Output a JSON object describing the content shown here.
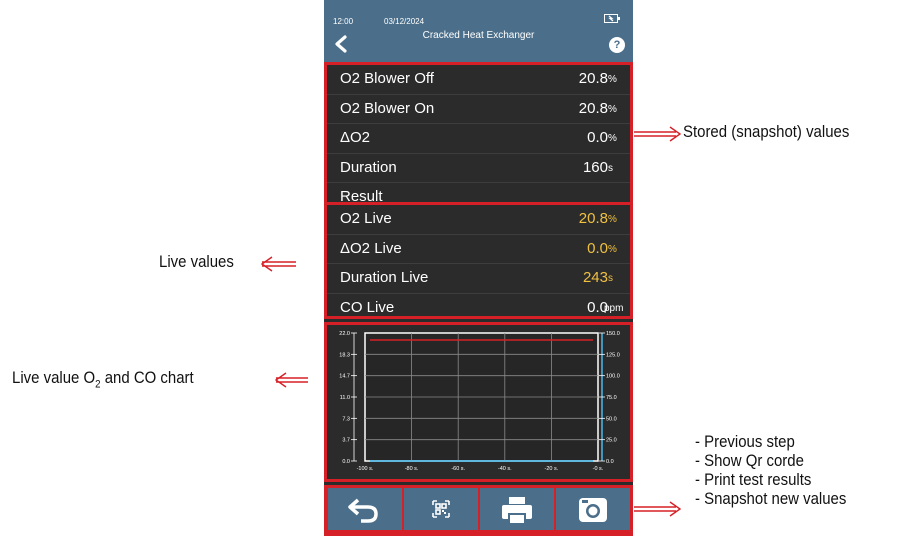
{
  "status_bar": {
    "time": "12:00",
    "date": "03/12/2024",
    "battery_icon": "battery-charging-icon"
  },
  "header": {
    "title": "Cracked Heat Exchanger",
    "back_icon": "chevron-left-icon",
    "help_label": "?"
  },
  "stored": {
    "rows": [
      {
        "label": "O2 Blower Off",
        "value": "20.8",
        "unit": "%"
      },
      {
        "label": "O2 Blower On",
        "value": "20.8",
        "unit": "%"
      },
      {
        "label": "ΔO2",
        "value": "0.0",
        "unit": "%"
      },
      {
        "label": "Duration",
        "value": "160",
        "unit": "s"
      },
      {
        "label": "Result",
        "value": "",
        "unit": ""
      }
    ]
  },
  "live": {
    "rows": [
      {
        "label": "O2 Live",
        "value": "20.8",
        "unit": "%"
      },
      {
        "label": "ΔO2 Live",
        "value": "0.0",
        "unit": "%"
      },
      {
        "label": "Duration Live",
        "value": "243",
        "unit": "s"
      },
      {
        "label": "CO Live",
        "value": "0.0",
        "unit": "ppm"
      }
    ]
  },
  "chart_data": {
    "type": "line",
    "x_ticks": [
      "-100 s.",
      "-80 s.",
      "-60 s.",
      "-40 s.",
      "-20 s.",
      "-0 s."
    ],
    "y_left_ticks": [
      "22.0",
      "18.3",
      "14.7",
      "11.0",
      "7.3",
      "3.7",
      "0.0"
    ],
    "y_right_ticks": [
      "150.0",
      "125.0",
      "100.0",
      "75.0",
      "50.0",
      "25.0",
      "0.0"
    ],
    "y_left_lim": [
      0,
      22
    ],
    "y_right_lim": [
      0,
      150
    ],
    "grid": true,
    "series": [
      {
        "axis": "left",
        "color": "#d62027",
        "x": [
          -100,
          -80,
          -60,
          -40,
          -20,
          0
        ],
        "y": [
          20.8,
          20.8,
          20.8,
          20.8,
          20.8,
          20.8
        ]
      },
      {
        "axis": "right",
        "color": "#4fc3f7",
        "x": [
          -100,
          -80,
          -60,
          -40,
          -20,
          0
        ],
        "y": [
          0,
          0,
          0,
          0,
          0,
          0
        ]
      }
    ]
  },
  "toolbar": {
    "buttons": [
      {
        "icon": "undo-arrow-icon"
      },
      {
        "icon": "qr-code-icon"
      },
      {
        "icon": "printer-icon"
      },
      {
        "icon": "camera-icon"
      }
    ]
  },
  "annotations": {
    "stored": "Stored (snapshot) values",
    "live": "Live values",
    "chart_main": "Live value O",
    "chart_sub": "2",
    "chart_tail": " and CO chart",
    "toolbar_lines": [
      "- Previous step",
      "- Show Qr corde",
      "- Print test results",
      "- Snapshot new values"
    ]
  },
  "colors": {
    "accent_red": "#d62027",
    "header_blue": "#4b6f8a",
    "live_yellow": "#f0c040",
    "co_blue": "#4fc3f7"
  }
}
